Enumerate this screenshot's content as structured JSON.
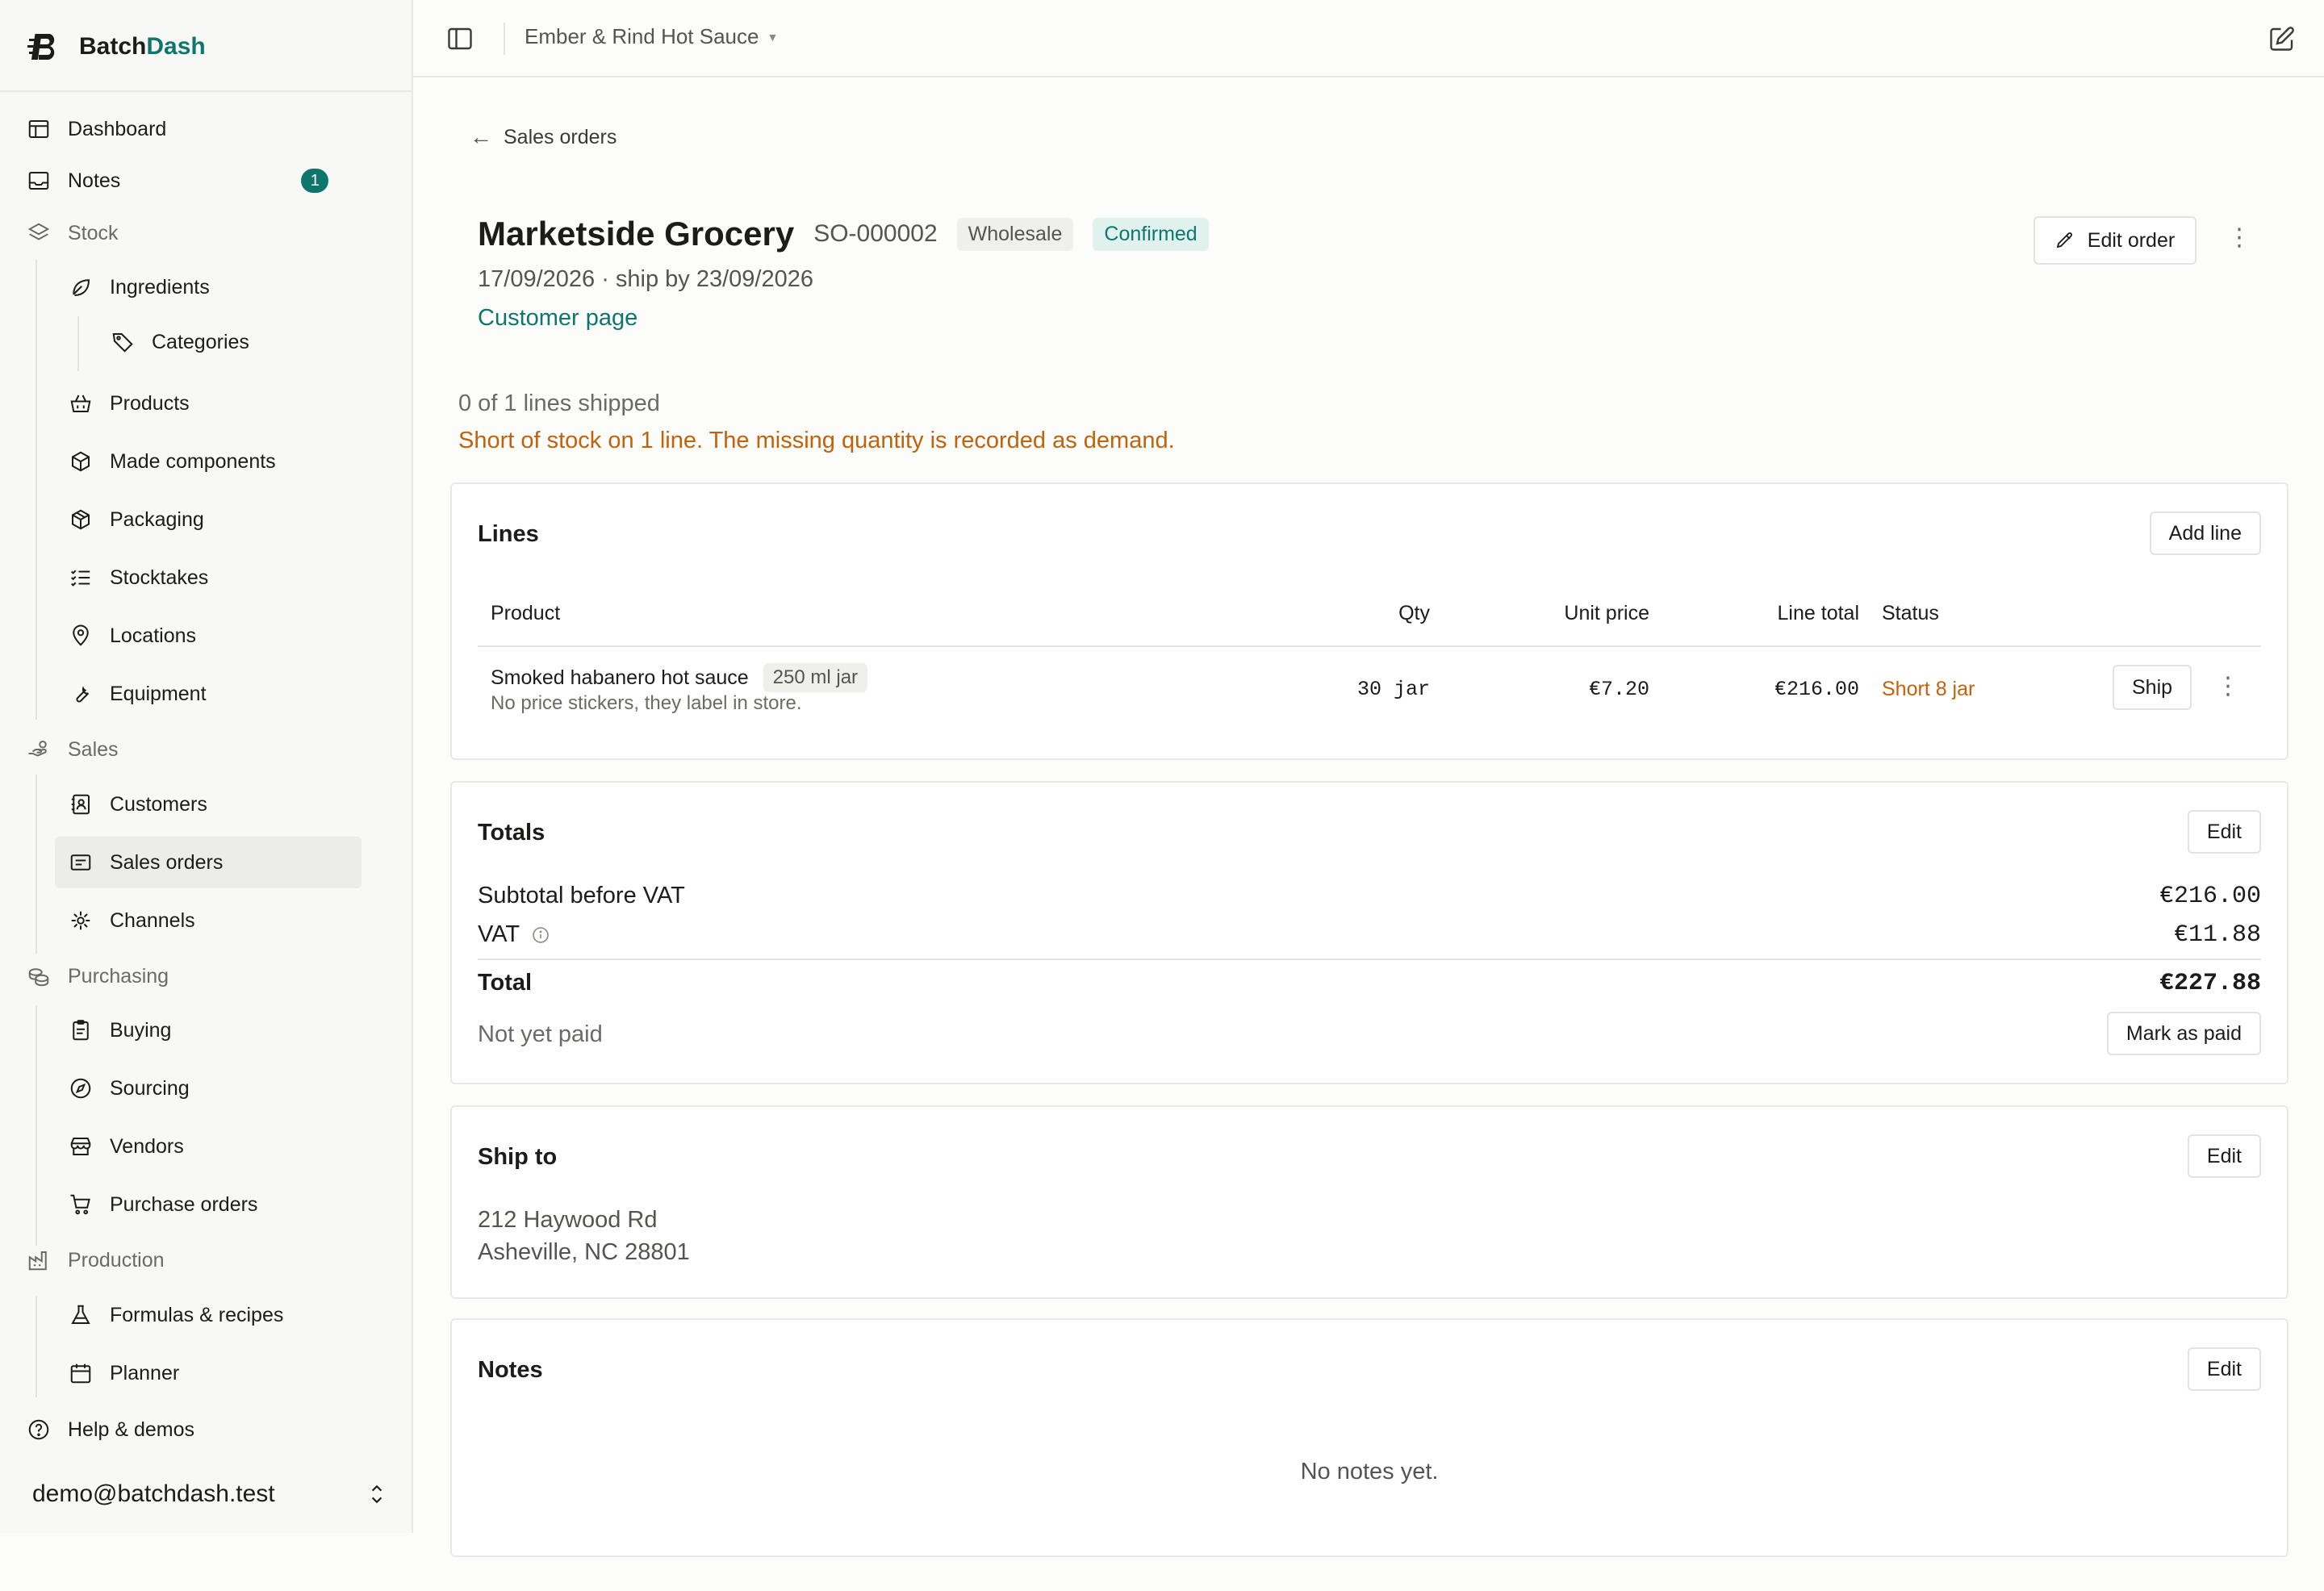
{
  "sidebar": {
    "brand": {
      "part1": "Batch",
      "part2": "Dash"
    },
    "items": {
      "dashboard": "Dashboard",
      "notes": "Notes",
      "notes_badge": "1",
      "stock": "Stock",
      "ingredients": "Ingredients",
      "categories": "Categories",
      "products": "Products",
      "made_components": "Made components",
      "packaging": "Packaging",
      "stocktakes": "Stocktakes",
      "locations": "Locations",
      "equipment": "Equipment",
      "sales": "Sales",
      "customers": "Customers",
      "sales_orders": "Sales orders",
      "channels": "Channels",
      "purchasing": "Purchasing",
      "buying": "Buying",
      "sourcing": "Sourcing",
      "vendors": "Vendors",
      "purchase_orders": "Purchase orders",
      "production": "Production",
      "formulas": "Formulas & recipes",
      "planner": "Planner",
      "help": "Help & demos"
    },
    "account": "demo@batchdash.test"
  },
  "topbar": {
    "workspace": "Ember & Rind Hot Sauce"
  },
  "main": {
    "back_label": "Sales orders",
    "customer_name": "Marketside Grocery",
    "order_number": "SO-000002",
    "channel_badge": "Wholesale",
    "status_badge": "Confirmed",
    "dates": "17/09/2026 · ship by 23/09/2026",
    "customer_link": "Customer page",
    "edit_order": "Edit order",
    "shipped_summary": "0 of 1 lines shipped",
    "stock_warning": "Short of stock on 1 line. The missing quantity is recorded as demand."
  },
  "lines": {
    "title": "Lines",
    "add_line": "Add line",
    "headers": {
      "product": "Product",
      "qty": "Qty",
      "unit_price": "Unit price",
      "line_total": "Line total",
      "status": "Status"
    },
    "rows": [
      {
        "product": "Smoked habanero hot sauce",
        "size": "250 ml jar",
        "note": "No price stickers, they label in store.",
        "qty": "30 jar",
        "unit_price": "€7.20",
        "line_total": "€216.00",
        "status": "Short 8 jar",
        "action": "Ship"
      }
    ]
  },
  "totals": {
    "title": "Totals",
    "edit": "Edit",
    "subtotal_label": "Subtotal before VAT",
    "subtotal": "€216.00",
    "vat_label": "VAT",
    "vat": "€11.88",
    "total_label": "Total",
    "total": "€227.88",
    "payment_status": "Not yet paid",
    "mark_paid": "Mark as paid"
  },
  "ship_to": {
    "title": "Ship to",
    "edit": "Edit",
    "line1": "212 Haywood Rd",
    "line2": "Asheville, NC 28801"
  },
  "notes": {
    "title": "Notes",
    "edit": "Edit",
    "empty": "No notes yet."
  },
  "colors": {
    "accent": "#0f766e",
    "warning": "#c2620a",
    "sidebar_bg": "#f8f8f6"
  }
}
